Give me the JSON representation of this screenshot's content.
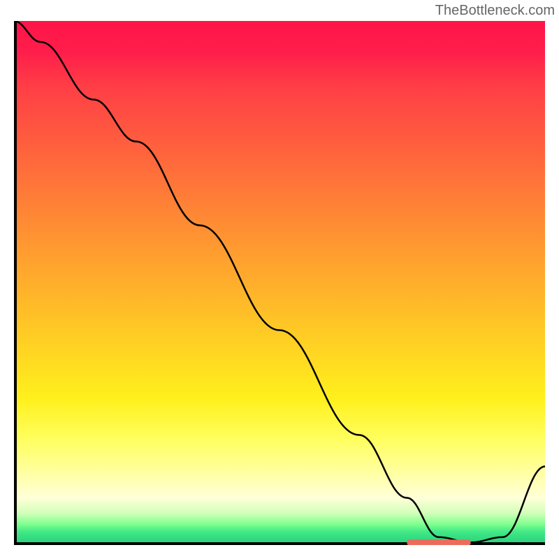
{
  "attribution": "TheBottleneck.com",
  "chart_data": {
    "type": "line",
    "title": "",
    "xlabel": "",
    "ylabel": "",
    "xlim": [
      0,
      100
    ],
    "ylim": [
      0,
      100
    ],
    "series": [
      {
        "name": "bottleneck-curve",
        "x": [
          0,
          5,
          15,
          23,
          35,
          50,
          65,
          74,
          80,
          86,
          92,
          100
        ],
        "values": [
          100,
          96,
          85,
          77,
          61,
          41,
          21,
          9,
          1.5,
          0.5,
          1.5,
          15
        ]
      }
    ],
    "marker": {
      "x_start": 74,
      "x_end": 86,
      "y": 0.5
    }
  },
  "colors": {
    "curve": "#000000",
    "axis": "#000000",
    "marker": "#ee6a5a"
  }
}
